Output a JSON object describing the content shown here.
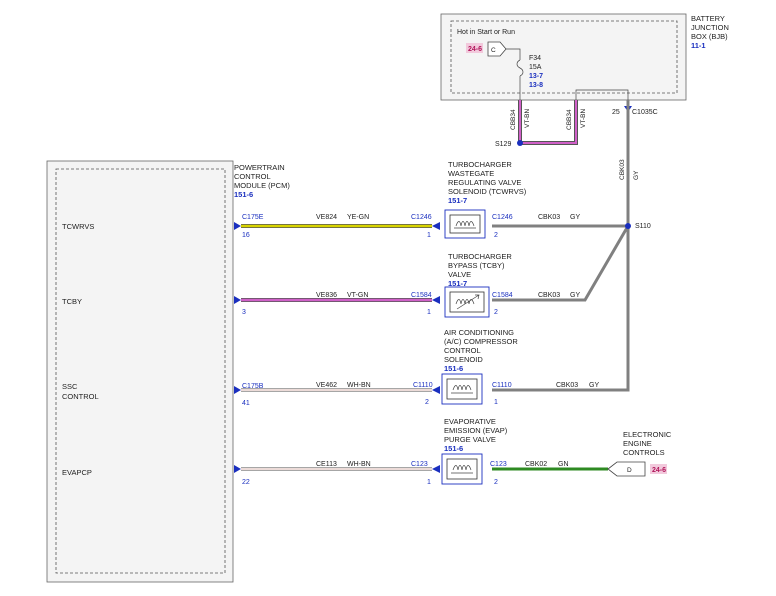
{
  "bjb": {
    "title": [
      "BATTERY",
      "JUNCTION",
      "BOX (BJB)"
    ],
    "ref": "11-1",
    "hot_label": "Hot in Start or Run",
    "ref_tag": "24-6",
    "c_label": "C",
    "fuse": "F34",
    "fuse_amp": "15A",
    "fuse_ref1": "13-7",
    "fuse_ref2": "13-8",
    "pin25": "25",
    "conn": "C1035C",
    "wire1_code": "CBB34",
    "wire1_color": "VT-BN",
    "wire2_code": "CBB34",
    "wire2_color": "VT-BN",
    "splice": "S129",
    "gy_code": "CBK03",
    "gy_color": "GY",
    "splice110": "S110"
  },
  "pcm": {
    "title": [
      "POWERTRAIN",
      "CONTROL",
      "MODULE (PCM)"
    ],
    "ref": "151-6",
    "pins": [
      {
        "name": "TCWRVS",
        "conn": "C175E",
        "pin": "16"
      },
      {
        "name": "TCBY",
        "conn": "",
        "pin": "3"
      },
      {
        "name": "SSC",
        "name2": "CONTROL",
        "conn": "C175B",
        "pin": "41"
      },
      {
        "name": "EVAPCP",
        "conn": "",
        "pin": "22"
      }
    ]
  },
  "circuits": [
    {
      "code": "VE824",
      "color": "YE-GN",
      "in_conn": "C1246",
      "in_pin": "1",
      "out_conn": "C1246",
      "out_pin": "2",
      "out_code": "CBK03",
      "out_color": "GY"
    },
    {
      "code": "VE836",
      "color": "VT-GN",
      "in_conn": "C1584",
      "in_pin": "1",
      "out_conn": "C1584",
      "out_pin": "2",
      "out_code": "CBK03",
      "out_color": "GY"
    },
    {
      "code": "VE462",
      "color": "WH-BN",
      "in_conn": "C1110",
      "in_pin": "2",
      "out_conn": "C1110",
      "out_pin": "1",
      "out_code": "CBK03",
      "out_color": "GY"
    },
    {
      "code": "CE113",
      "color": "WH-BN",
      "in_conn": "C123",
      "in_pin": "1",
      "out_conn": "C123",
      "out_pin": "2",
      "out_code": "CBK02",
      "out_color": "GN"
    }
  ],
  "components": [
    {
      "lines": [
        "TURBOCHARGER",
        "WASTEGATE",
        "REGULATING VALVE",
        "SOLENOID (TCWRVS)"
      ],
      "ref": "151-7"
    },
    {
      "lines": [
        "TURBOCHARGER",
        "BYPASS (TCBY)",
        "VALVE"
      ],
      "ref": "151-7"
    },
    {
      "lines": [
        "AIR CONDITIONING",
        "(A/C) COMPRESSOR",
        "CONTROL",
        "SOLENOID"
      ],
      "ref": "151-6"
    },
    {
      "lines": [
        "EVAPORATIVE",
        "EMISSION (EVAP)",
        "PURGE VALVE"
      ],
      "ref": "151-6"
    }
  ],
  "eec": {
    "title": [
      "ELECTRONIC",
      "ENGINE",
      "CONTROLS"
    ],
    "letter": "D",
    "ref_tag": "24-6"
  },
  "colors": {
    "ye_gn": "#d8d400",
    "vt": "#d060c8",
    "gy": "#808080",
    "gn": "#2e8a22",
    "wh_bn": "#d9b7b2",
    "accent": "#1a2fbf",
    "tag": "#b0155a"
  }
}
